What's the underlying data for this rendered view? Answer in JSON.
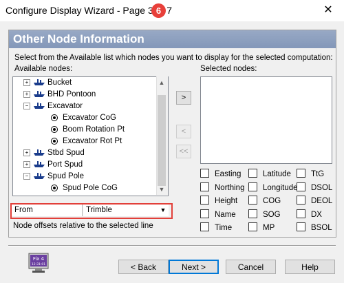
{
  "window": {
    "title": "Configure Display Wizard - Page 3 of 7",
    "step_badge": "6",
    "close_glyph": "✕"
  },
  "header": {
    "title": "Other Node Information",
    "instruction": "Select from the Available list which nodes you want to display for the selected computation:"
  },
  "available": {
    "label": "Available nodes:",
    "nodes": [
      {
        "label": "Bucket",
        "level": 0,
        "expander": "+"
      },
      {
        "label": "BHD Pontoon",
        "level": 0,
        "expander": "+"
      },
      {
        "label": "Excavator",
        "level": 0,
        "expander": "−"
      },
      {
        "label": "Excavator CoG",
        "level": 1
      },
      {
        "label": "Boom Rotation Pt",
        "level": 1
      },
      {
        "label": "Excavator Rot Pt",
        "level": 1
      },
      {
        "label": "Stbd Spud",
        "level": 0,
        "expander": "+"
      },
      {
        "label": "Port Spud",
        "level": 0,
        "expander": "+"
      },
      {
        "label": "Spud Pole",
        "level": 0,
        "expander": "−"
      },
      {
        "label": "Spud Pole CoG",
        "level": 1
      }
    ]
  },
  "selected": {
    "label": "Selected nodes:"
  },
  "transfer": {
    "add": ">",
    "remove": "<",
    "remove_all": "<<"
  },
  "checkboxes": {
    "col1": [
      "Easting",
      "Northing",
      "Height",
      "Name",
      "Time"
    ],
    "col2": [
      "Latitude",
      "Longitude",
      "COG",
      "SOG",
      "MP"
    ],
    "col3": [
      "TtG",
      "DSOL",
      "DEOL",
      "DX",
      "BSOL"
    ]
  },
  "from_row": {
    "label": "From",
    "value": "Trimble",
    "note": "Node offsets relative to the selected line"
  },
  "footer": {
    "icon_text": "Fix 4",
    "icon_time": "12:31:01",
    "back": "< Back",
    "next": "Next >",
    "cancel": "Cancel",
    "help": "Help"
  },
  "colors": {
    "header_band": "#8a9cbd",
    "highlight_red": "#e2403a",
    "default_button_border": "#0078d7"
  }
}
